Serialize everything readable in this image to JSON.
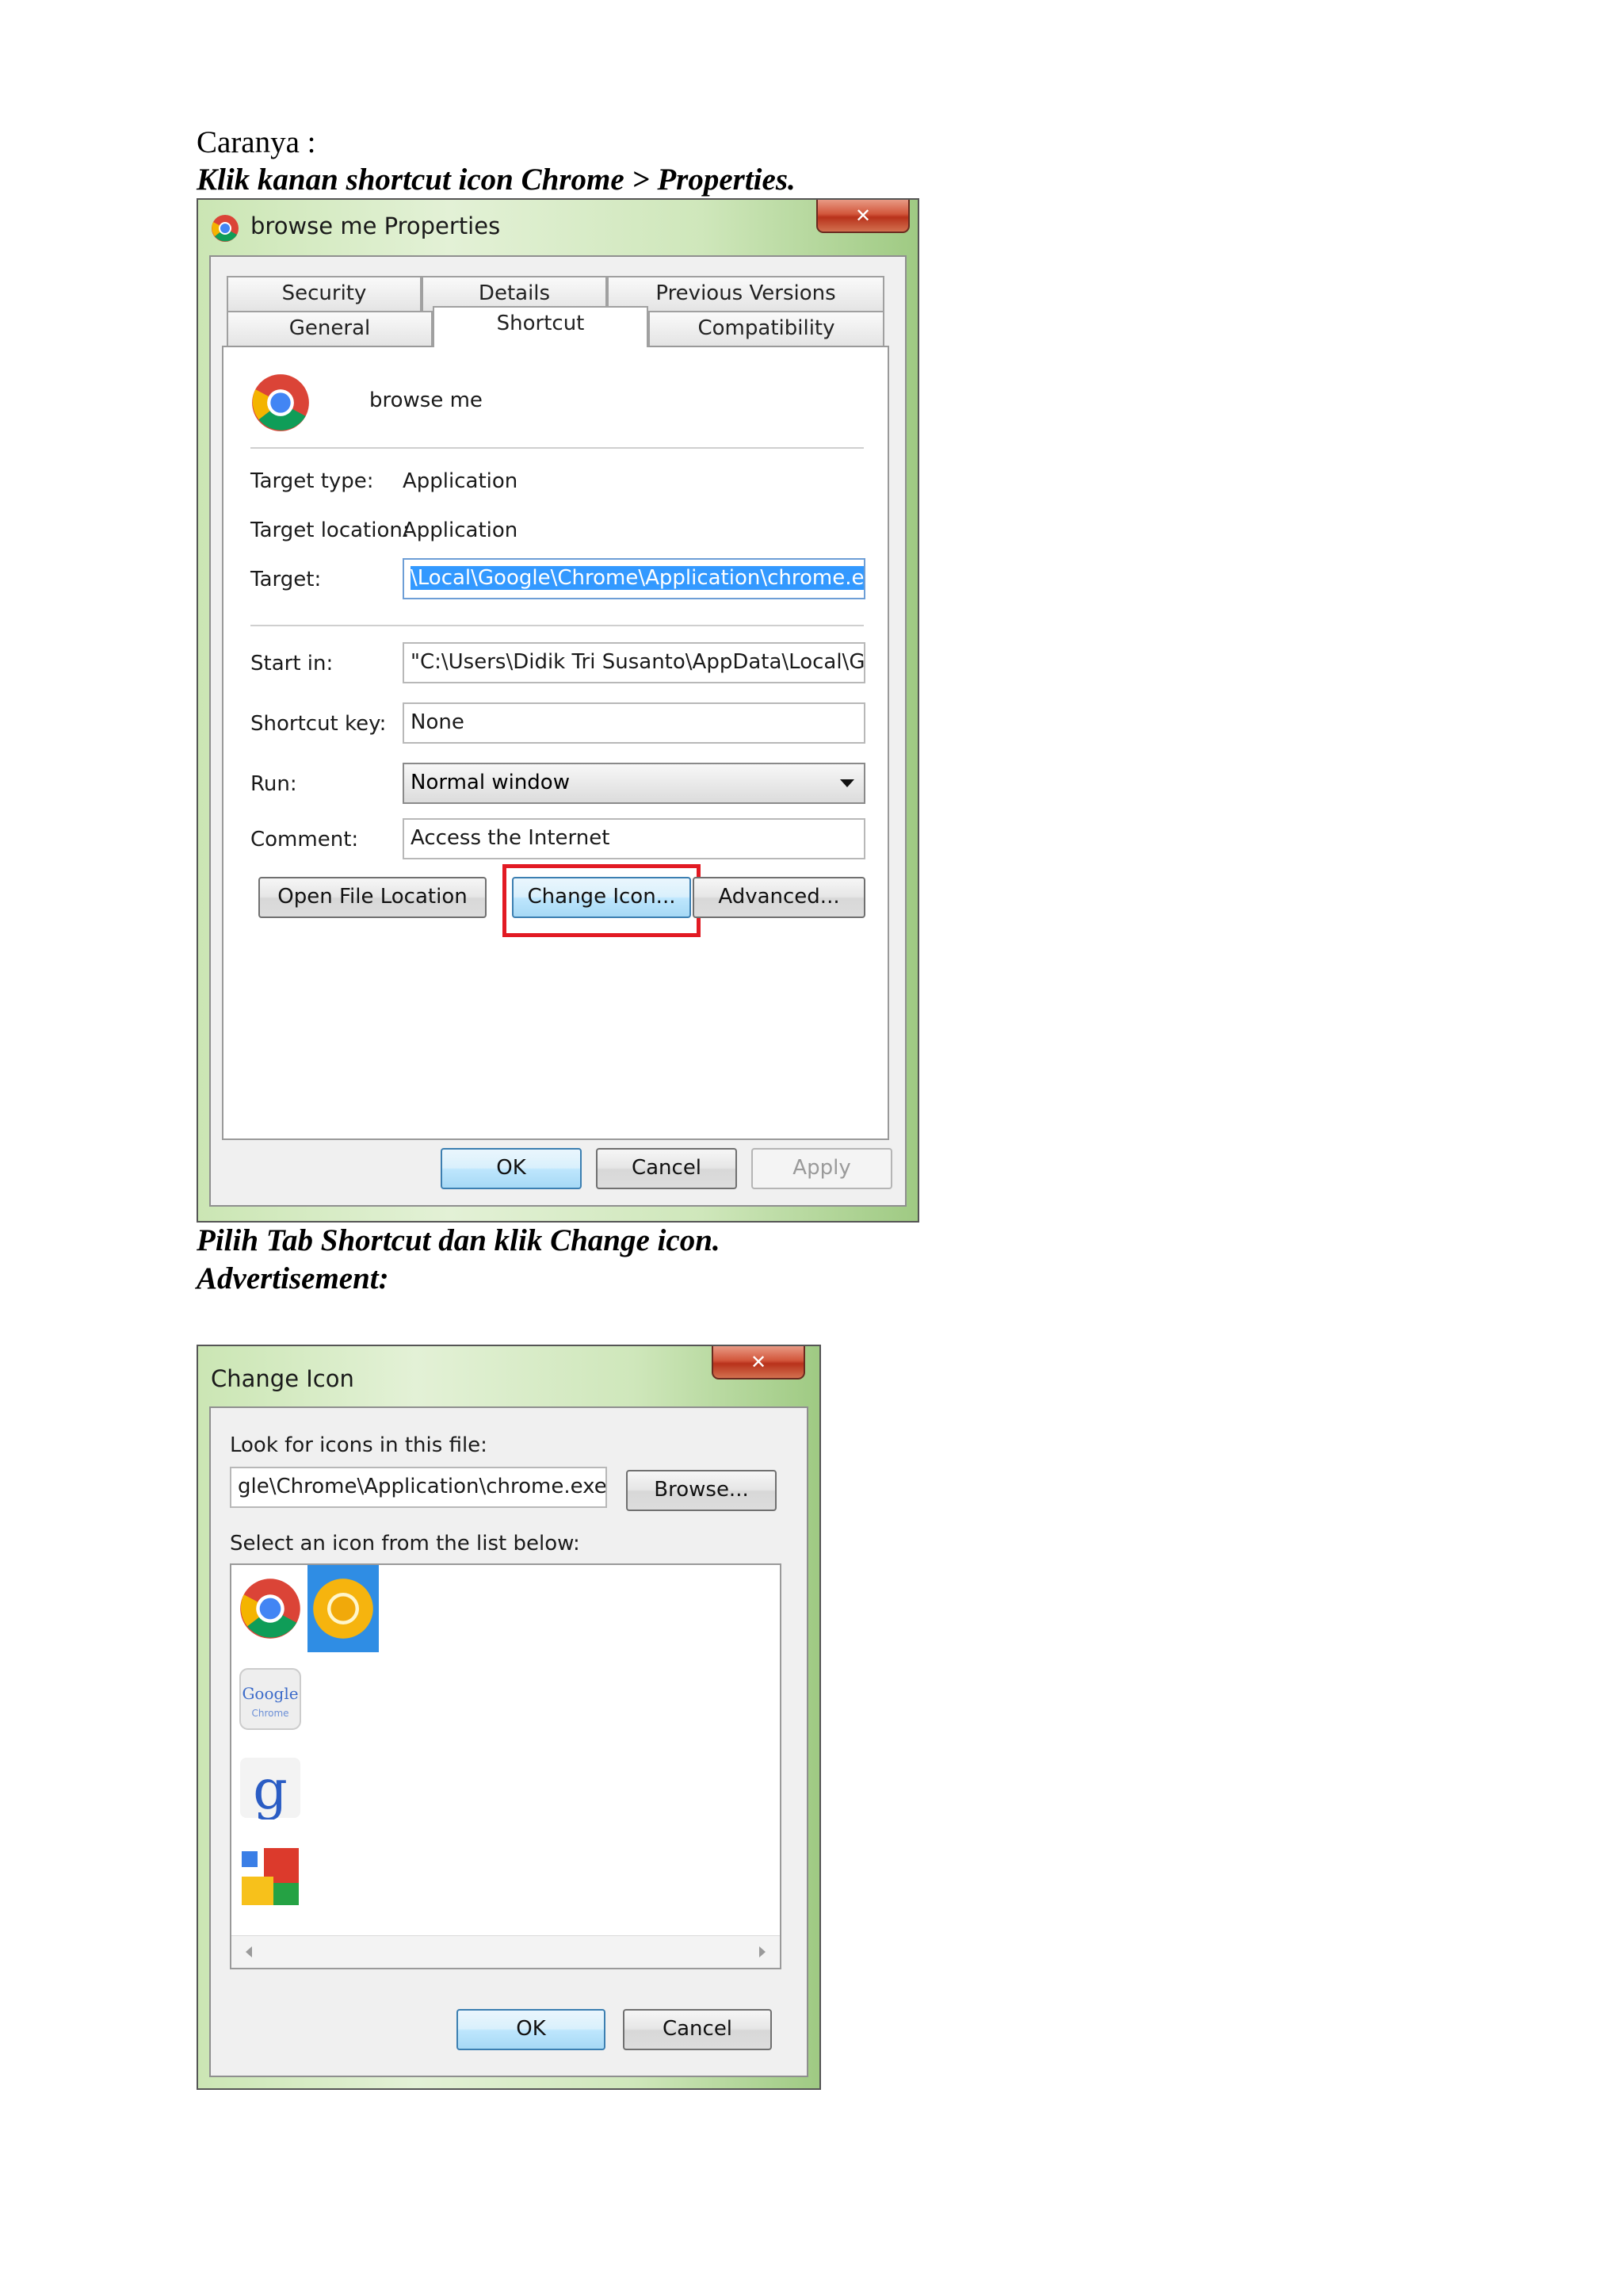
{
  "doc": {
    "intro": "Caranya :",
    "step1": "Klik kanan shortcut icon Chrome > Properties.",
    "step2": "Pilih Tab Shortcut dan klik Change icon.",
    "advert": "Advertisement:"
  },
  "properties_window": {
    "title": "browse me Properties",
    "close_symbol": "✕",
    "tabs_row1": [
      "Security",
      "Details",
      "Previous Versions"
    ],
    "tabs_row2": [
      "General",
      "Shortcut",
      "Compatibility"
    ],
    "active_tab": "Shortcut",
    "shortcut_name": "browse me",
    "target_type_label": "Target type:",
    "target_type_value": "Application",
    "target_location_label": "Target location:",
    "target_location_value": "Application",
    "target_label": "Target:",
    "target_value": "\\Local\\Google\\Chrome\\Application\\chrome.exe\"",
    "start_in_label": "Start in:",
    "start_in_value": "\"C:\\Users\\Didik Tri Susanto\\AppData\\Local\\Goo",
    "shortcut_key_label": "Shortcut key:",
    "shortcut_key_value": "None",
    "run_label": "Run:",
    "run_value": "Normal window",
    "comment_label": "Comment:",
    "comment_value": "Access the Internet",
    "btn_open_location": "Open File Location",
    "btn_change_icon": "Change Icon...",
    "btn_advanced": "Advanced...",
    "btn_ok": "OK",
    "btn_cancel": "Cancel",
    "btn_apply": "Apply"
  },
  "change_icon_window": {
    "title": "Change Icon",
    "close_symbol": "✕",
    "look_label": "Look for icons in this file:",
    "file_value": "gle\\Chrome\\Application\\chrome.exe",
    "btn_browse": "Browse...",
    "select_label": "Select an icon from the list below:",
    "icons": [
      "chrome-icon",
      "chrome-yellow-icon",
      "google-chrome-text-icon",
      "google-g-icon",
      "google-plus-squares-icon"
    ],
    "selected_icon": "chrome-yellow-icon",
    "btn_ok": "OK",
    "btn_cancel": "Cancel"
  },
  "colors": {
    "highlight": "#e21a23",
    "selection": "#2f8de4"
  }
}
